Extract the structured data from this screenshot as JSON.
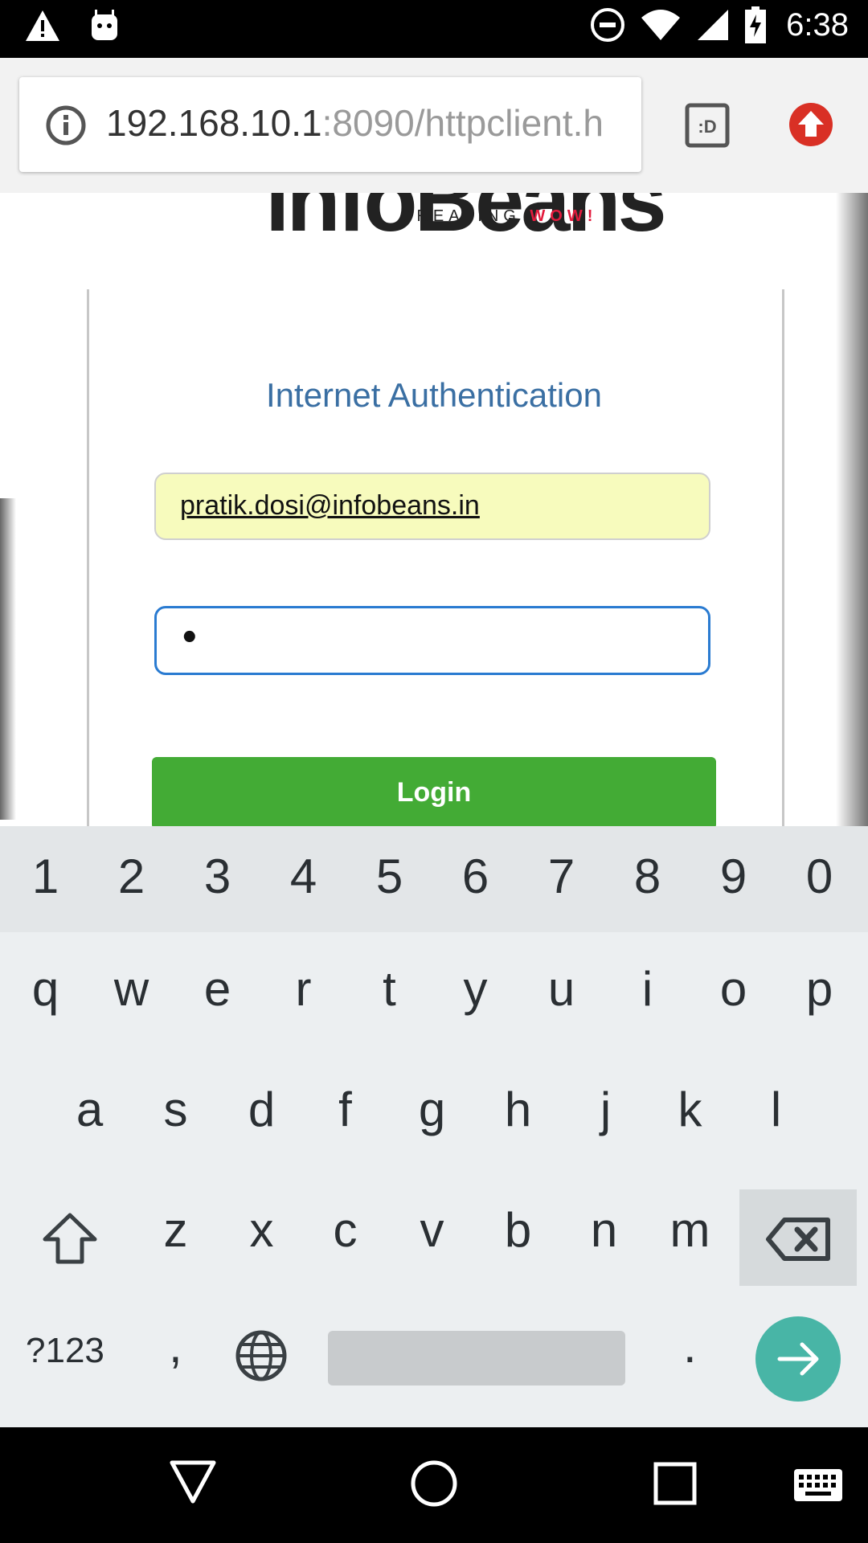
{
  "status_bar": {
    "time": "6:38",
    "icons": [
      "warning-icon",
      "android-icon",
      "do-not-disturb-icon",
      "wifi-icon",
      "signal-icon",
      "battery-charging-icon"
    ]
  },
  "browser": {
    "url_host": "192.168.10.1",
    "url_rest": ":8090/httpclient.h",
    "tab_count_label": ":D"
  },
  "page": {
    "logo_text": "infoBeans",
    "logo_tagline_a": "CREATING ",
    "logo_tagline_b": "WOW!",
    "title": "Internet Authentication",
    "email_value": "pratik.dosi@infobeans.in",
    "password_mask": "•",
    "login_label": "Login"
  },
  "keyboard": {
    "numbers": [
      "1",
      "2",
      "3",
      "4",
      "5",
      "6",
      "7",
      "8",
      "9",
      "0"
    ],
    "row1": [
      "q",
      "w",
      "e",
      "r",
      "t",
      "y",
      "u",
      "i",
      "o",
      "p"
    ],
    "row2": [
      "a",
      "s",
      "d",
      "f",
      "g",
      "h",
      "j",
      "k",
      "l"
    ],
    "row3": [
      "z",
      "x",
      "c",
      "v",
      "b",
      "n",
      "m"
    ],
    "symbols_label": "?123",
    "comma_label": ",",
    "period_label": "."
  },
  "colors": {
    "accent_blue": "#2a7bd1",
    "login_green": "#43ab35",
    "title_blue": "#3a6fa3",
    "autofill_yellow": "#f7fbbd",
    "enter_teal": "#48b5a6"
  }
}
